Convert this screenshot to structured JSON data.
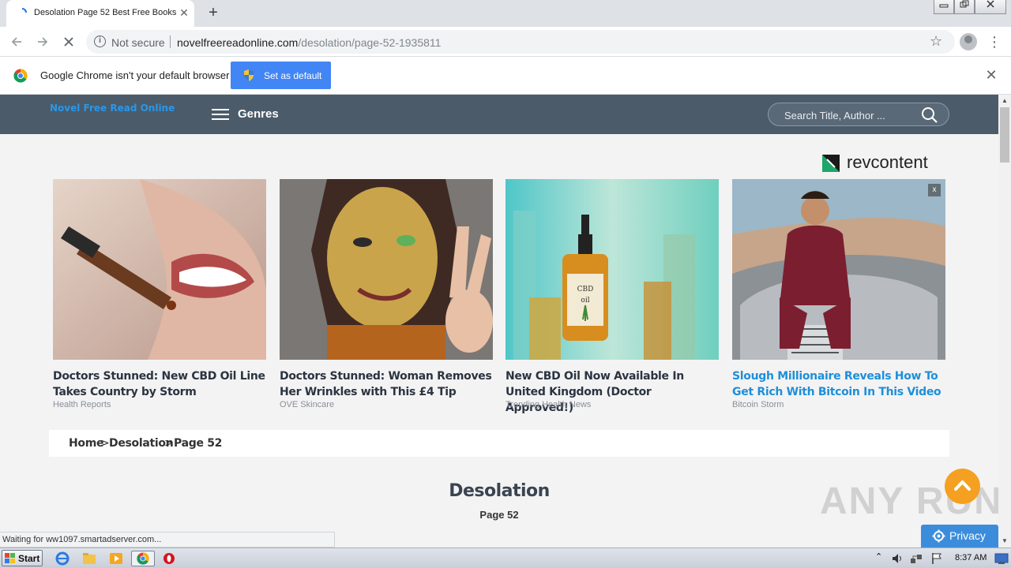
{
  "browser": {
    "tab_title": "Desolation Page 52 Best Free Books",
    "tab_close": "✕",
    "new_tab": "+",
    "security_label": "Not secure",
    "url_host": "novelfreereadonline.com",
    "url_path": "/desolation/page-52-1935811"
  },
  "infobar": {
    "message": "Google Chrome isn't your default browser",
    "button_label": "Set as default",
    "close": "✕"
  },
  "site": {
    "logo": "Novel Free Read Online",
    "genres_label": "Genres",
    "search_placeholder": "Search Title, Author ..."
  },
  "ads": {
    "brand": "revcontent",
    "close_label": "x",
    "cards": [
      {
        "headline": "Doctors Stunned: New CBD Oil Line Takes Country by Storm",
        "source": "Health Reports",
        "image": "woman-cbd-dropper-photo"
      },
      {
        "headline": "Doctors Stunned: Woman Removes Her Wrinkles with This £4 Tip",
        "source": "OVE Skincare",
        "image": "woman-gold-face-mask-photo"
      },
      {
        "headline": "New CBD Oil Now Available In United Kingdom (Doctor Approved!)",
        "source": "Trending Health News",
        "image": "cbd-oil-bottle-photo"
      },
      {
        "headline": "Slough Millionaire Reveals How To Get Rich With Bitcoin In This Video",
        "source": "Bitcoin Storm",
        "image": "man-on-luxury-car-photo"
      }
    ]
  },
  "breadcrumb": {
    "home": "Home",
    "sep1": ">",
    "book": "Desolation",
    "sep2": ">",
    "page": "Page 52"
  },
  "content": {
    "title": "Desolation",
    "page": "Page 52"
  },
  "overlays": {
    "privacy_label": "Privacy",
    "watermark": "ANY RUN",
    "status": "Waiting for ww1097.smartadserver.com..."
  },
  "taskbar": {
    "start_label": "Start",
    "clock": "8:37 AM"
  },
  "colors": {
    "site_header": "#4b5b6a",
    "logo_blue": "#2a97e8",
    "chrome_blue": "#4285f4",
    "scroll_top_orange": "#f5a021",
    "link_blue": "#1e8fd8"
  }
}
